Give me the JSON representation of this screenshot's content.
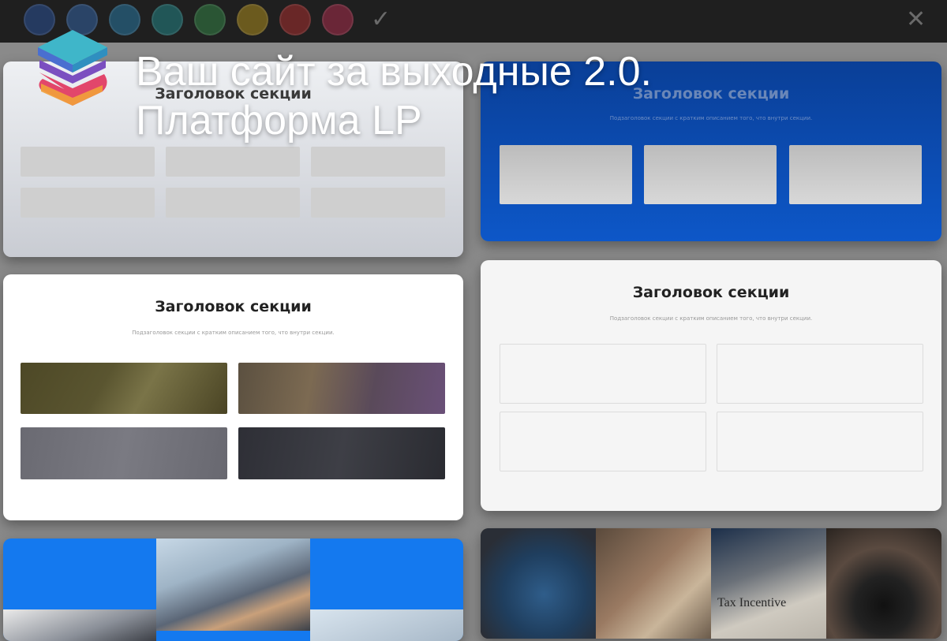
{
  "hero": {
    "line1": "Ваш сайт за выходные 2.0.",
    "line2": "Платформа LP"
  },
  "toolbar": {
    "swatches": [
      "#2a3e6b",
      "#2a4666",
      "#235566",
      "#245a5a",
      "#2d5a36",
      "#6a5a20",
      "#6a2a2a",
      "#6a2a3a"
    ],
    "icons": [
      "check-icon",
      "close-icon"
    ]
  },
  "sections": [
    {
      "id": "top-left",
      "title": "Заголовок секции",
      "subtitle": "",
      "theme": "light-gray"
    },
    {
      "id": "top-right",
      "title": "Заголовок секции",
      "subtitle": "Подзаголовок секции с кратким описанием того, что внутри секции.",
      "theme": "blue"
    },
    {
      "id": "mid-left",
      "title": "Заголовок секции",
      "subtitle": "Подзаголовок секции с кратким описанием того, что внутри секции.",
      "theme": "white-gallery"
    },
    {
      "id": "mid-right",
      "title": "Заголовок секции",
      "subtitle": "Подзаголовок секции с кратким описанием того, что внутри секции.",
      "theme": "white-outline"
    },
    {
      "id": "bottom-left",
      "title": "",
      "subtitle": "",
      "theme": "blue-checker"
    },
    {
      "id": "bottom-right",
      "title": "",
      "subtitle": "Tax Incentive",
      "theme": "photo-strip"
    }
  ],
  "colors": {
    "blue": "#0b57c9",
    "bright_blue": "#1479ef",
    "white": "#ffffff",
    "light_gray": "#d4d6dc"
  }
}
